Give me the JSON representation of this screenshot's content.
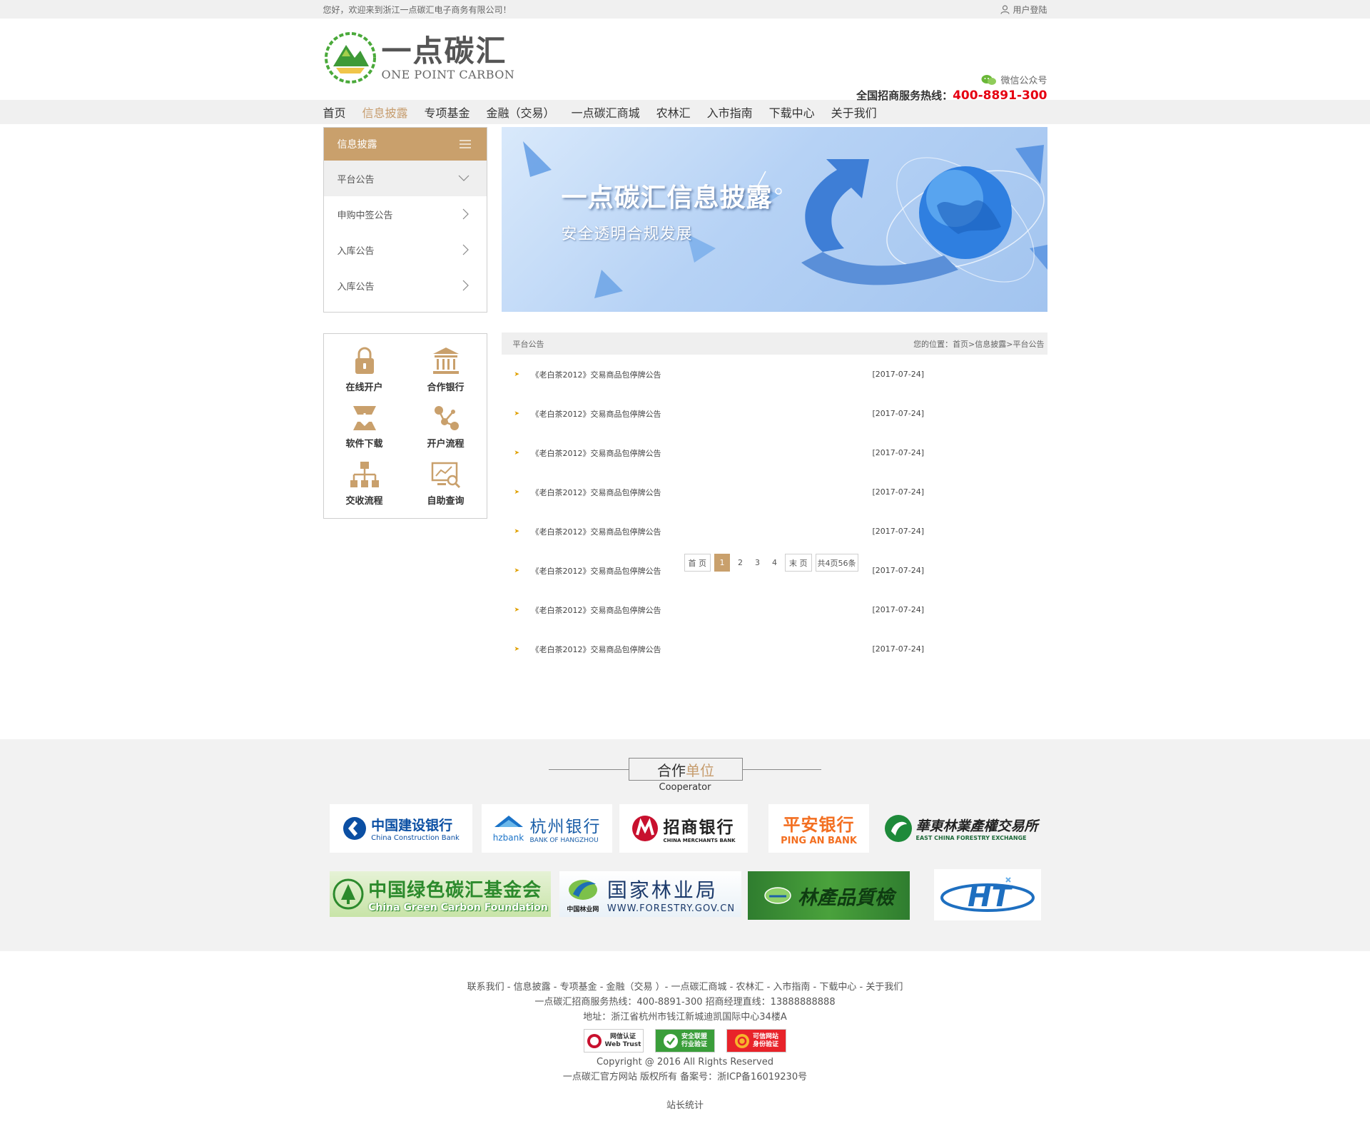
{
  "topbar": {
    "welcome": "您好，欢迎来到浙江一点碳汇电子商务有限公司！",
    "login": "用户登陆"
  },
  "header": {
    "logo_cn": "一点碳汇",
    "logo_en": "ONE POINT CARBON",
    "wechat": "微信公众号",
    "hotline_label": "全国招商服务热线：",
    "hotline_number": "400-8891-300"
  },
  "nav": {
    "items": [
      "首页",
      "信息披露",
      "专项基金",
      "金融（交易）",
      "一点碳汇商城",
      "农林汇",
      "入市指南",
      "下载中心",
      "关于我们"
    ],
    "active_index": 1
  },
  "sidebar": {
    "title": "信息披露",
    "items": [
      "平台公告",
      "申购中签公告",
      "入库公告",
      "入库公告"
    ]
  },
  "quick_links": [
    "在线开户",
    "合作银行",
    "软件下载",
    "开户流程",
    "交收流程",
    "自助查询"
  ],
  "banner": {
    "title": "一点碳汇信息披露",
    "subtitle": "安全透明合规发展"
  },
  "list": {
    "title": "平台公告",
    "location_label": "您的位置：",
    "breadcrumb": "首页>信息披露>平台公告",
    "rows": [
      {
        "title": "《老白茶2012》交易商品包停牌公告",
        "date": "[2017-07-24]"
      },
      {
        "title": "《老白茶2012》交易商品包停牌公告",
        "date": "[2017-07-24]"
      },
      {
        "title": "《老白茶2012》交易商品包停牌公告",
        "date": "[2017-07-24]"
      },
      {
        "title": "《老白茶2012》交易商品包停牌公告",
        "date": "[2017-07-24]"
      },
      {
        "title": "《老白茶2012》交易商品包停牌公告",
        "date": "[2017-07-24]"
      },
      {
        "title": "《老白茶2012》交易商品包停牌公告",
        "date": "[2017-07-24]"
      },
      {
        "title": "《老白茶2012》交易商品包停牌公告",
        "date": "[2017-07-24]"
      },
      {
        "title": "《老白茶2012》交易商品包停牌公告",
        "date": "[2017-07-24]"
      }
    ]
  },
  "pager": {
    "first": "首 页",
    "pages": [
      "1",
      "2",
      "3",
      "4"
    ],
    "last": "末 页",
    "summary": "共4页56条"
  },
  "partners": {
    "title_a": "合作",
    "title_b": "单位",
    "title_en": "Cooperator",
    "ccb": {
      "cn": "中国建设银行",
      "en": "China Construction Bank"
    },
    "hz": {
      "cn": "杭州银行",
      "brand": "hzbank",
      "en": "BANK OF HANGZHOU"
    },
    "cmb": {
      "cn": "招商银行",
      "en": "CHINA MERCHANTS BANK"
    },
    "pingan": {
      "cn": "平安银行",
      "en": "PING AN BANK"
    },
    "ecfe": {
      "cn": "華東林業產權交易所",
      "en": "EAST CHINA FORESTRY EXCHANGE"
    },
    "cgcf": {
      "cn": "中国绿色碳汇基金会",
      "en": "China Green Carbon Foundation"
    },
    "forestry": {
      "cn": "国家林业局",
      "small": "中国林业网",
      "url": "WWW.FORESTRY.GOV.CN"
    },
    "linchan": {
      "cn": "林產品質檢"
    },
    "ht": {
      "text": "HT"
    }
  },
  "footer": {
    "links": "联系我们 - 信息披露 - 专项基金 - 金融（交易 ）- 一点碳汇商城 - 农林汇 - 入市指南 - 下载中心 - 关于我们",
    "contact": "一点碳汇招商服务热线：400-8891-300    招商经理直线：13888888888",
    "address": "地址：浙江省杭州市钱江新城迪凯国际中心34楼A",
    "badges": [
      {
        "l1": "网信认证",
        "l2": "Web Trust"
      },
      {
        "l1": "安全联盟",
        "l2": "行业验证"
      },
      {
        "l1": "可信网站",
        "l2": "身份验证"
      }
    ],
    "copyright": "Copyright @ 2016 All Rights Reserved",
    "icp": "一点碳汇官方网站 版权所有 备案号：浙ICP备16019230号",
    "stat": "站长统计"
  },
  "colors": {
    "accent": "#c9a06c",
    "hotline": "#e60012",
    "bullet": "#e0a000"
  }
}
